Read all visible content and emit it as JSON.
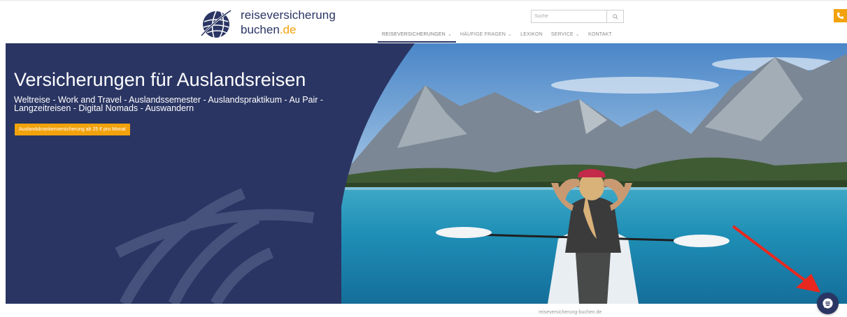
{
  "header": {
    "logo_line1": "reiseversicherung",
    "logo_line2_main": "buchen",
    "logo_line2_domain": ".de",
    "search_placeholder": "Suche",
    "nav": [
      {
        "label": "REISEVERSICHERUNGEN",
        "dropdown": true,
        "active": true
      },
      {
        "label": "HÄUFIGE FRAGEN",
        "dropdown": true,
        "active": false
      },
      {
        "label": "LEXIKON",
        "dropdown": false,
        "active": false
      },
      {
        "label": "SERVICE",
        "dropdown": true,
        "active": false
      },
      {
        "label": "KONTAKT",
        "dropdown": false,
        "active": false
      }
    ],
    "phone_icon": "phone-icon",
    "search_icon": "search-icon"
  },
  "hero": {
    "title": "Versicherungen für Auslandsreisen",
    "subtitle": "Weltreise - Work and Travel - Auslandssemester - Auslandspraktikum - Au Pair - Langzeitreisen - Digital Nomads - Auswandern",
    "cta_label": "Auslandskrankenversicherung ab 25 € pro Monat"
  },
  "footer": {
    "caption": "reiseversicherung-buchen.de"
  },
  "chat": {
    "icon": "chat-icon"
  },
  "colors": {
    "brand_navy": "#2a3563",
    "accent_orange": "#f2a20c",
    "annotation_red": "#e8281e"
  }
}
